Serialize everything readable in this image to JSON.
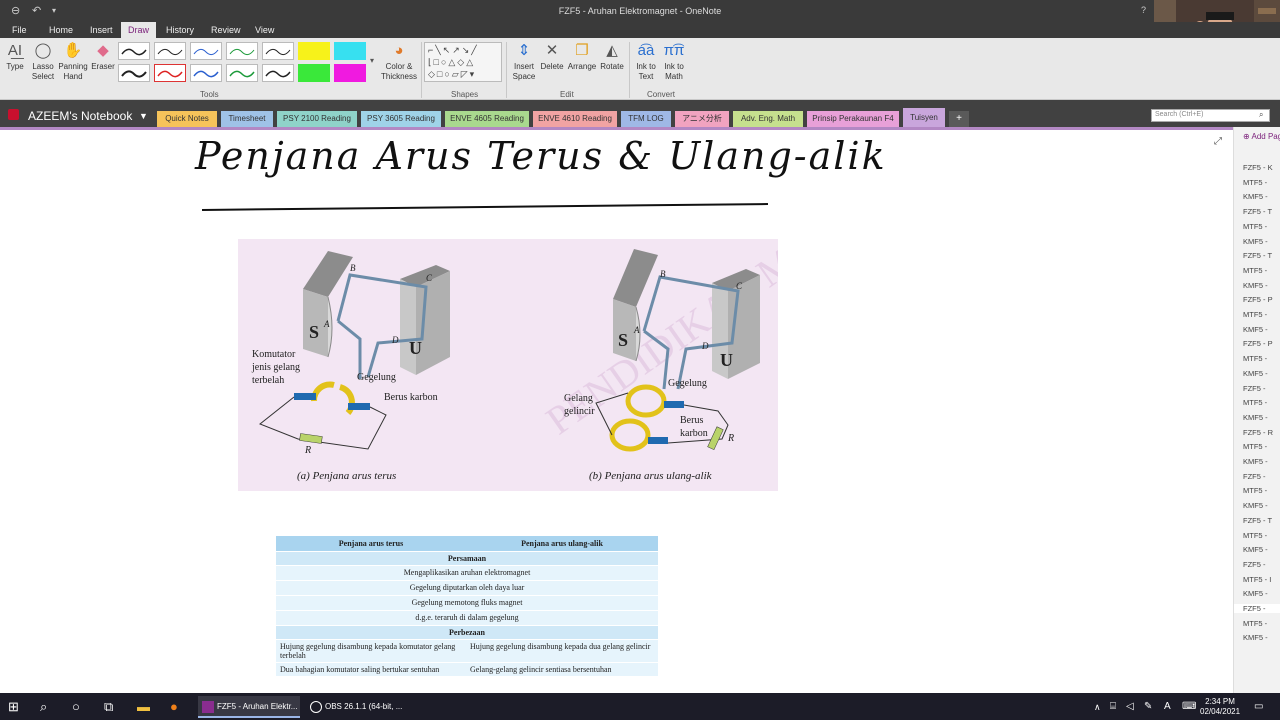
{
  "window": {
    "title": "FZF5 - Aruhan Elektromagnet - OneNote",
    "help_glyph": "?"
  },
  "menu": {
    "items": [
      "File",
      "Home",
      "Insert",
      "Draw",
      "History",
      "Review",
      "View"
    ],
    "active": "Draw"
  },
  "ribbon": {
    "tools": {
      "type": "Type",
      "lasso_1": "Lasso",
      "lasso_2": "Select",
      "panning_1": "Panning",
      "panning_2": "Hand",
      "eraser": "Eraser",
      "color_1": "Color &",
      "color_2": "Thickness",
      "group": "Tools"
    },
    "shapes_group": "Shapes",
    "edit": {
      "insert_1": "Insert",
      "insert_2": "Space",
      "delete": "Delete",
      "arrange": "Arrange",
      "rotate": "Rotate",
      "group": "Edit"
    },
    "convert": {
      "ink_text_1": "Ink to",
      "ink_text_2": "Text",
      "ink_math_1": "Ink to",
      "ink_math_2": "Math",
      "group": "Convert"
    }
  },
  "notebook": {
    "name": "AZEEM's Notebook",
    "tabs": [
      {
        "label": "Quick Notes",
        "color": "#f6c35a"
      },
      {
        "label": "Timesheet",
        "color": "#9fc2e7"
      },
      {
        "label": "PSY 2100 Reading",
        "color": "#8fd3c9"
      },
      {
        "label": "PSY 3605 Reading",
        "color": "#9fd3e8"
      },
      {
        "label": "ENVE 4605 Reading",
        "color": "#a9d98e"
      },
      {
        "label": "ENVE 4610 Reading",
        "color": "#f1a3a3"
      },
      {
        "label": "TFM LOG",
        "color": "#9fb8e6"
      },
      {
        "label": "アニメ分析",
        "color": "#f1a3c0"
      },
      {
        "label": "Adv. Eng. Math",
        "color": "#c6e08e"
      },
      {
        "label": "Prinsip Perakaunan F4",
        "color": "#e8a0d8"
      },
      {
        "label": "Tuisyen",
        "color": "#c9a6dc"
      }
    ],
    "add_tab": "+",
    "search_placeholder": "Search (Ctrl+E)"
  },
  "page": {
    "title": "Penjana Arus Terus & Ulang-alik"
  },
  "figure": {
    "a": {
      "caption": "(a) Penjana arus terus",
      "komutator": [
        "Komutator",
        "jenis gelang",
        "terbelah"
      ],
      "gegelung": "Gegelung",
      "berus": "Berus karbon",
      "R": "R",
      "S": "S",
      "U": "U",
      "A": "A",
      "B": "B",
      "C": "C",
      "D": "D"
    },
    "b": {
      "caption": "(b) Penjana arus ulang-alik",
      "gelang": [
        "Gelang",
        "gelincir"
      ],
      "gegelung": "Gegelung",
      "berus": [
        "Berus",
        "karbon"
      ],
      "R": "R",
      "S": "S",
      "U": "U",
      "A": "A",
      "B": "B",
      "C": "C",
      "D": "D"
    }
  },
  "table": {
    "headers": [
      "Penjana arus terus",
      "Penjana arus ulang-alik"
    ],
    "persamaan_label": "Persamaan",
    "persamaan": [
      "Mengaplikasikan aruhan elektromagnet",
      "Gegelung diputarkan oleh daya luar",
      "Gegelung memotong fluks magnet",
      "d.g.e. teraruh di dalam gegelung"
    ],
    "perbezaan_label": "Perbezaan",
    "perbezaan": [
      [
        "Hujung gegelung disambung kepada komutator gelang terbelah",
        "Hujung gegelung disambung kepada dua gelang gelincir"
      ],
      [
        "Dua bahagian komutator saling bertukar sentuhan",
        "Gelang-gelang gelincir sentiasa bersentuhan"
      ]
    ]
  },
  "sidepanel": {
    "add_page": "Add Page",
    "pages": [
      "FZF5 - K",
      "MTF5 -",
      "KMF5 -",
      "FZF5 - T",
      "MTF5 -",
      "KMF5 -",
      "FZF5 - T",
      "MTF5 -",
      "KMF5 -",
      "FZF5 - P",
      "MTF5 -",
      "KMF5 -",
      "FZF5 - P",
      "MTF5 -",
      "KMF5 -",
      "FZF5 -",
      "MTF5 -",
      "KMF5 -",
      "FZF5 - R",
      "MTF5 -",
      "KMF5 -",
      "FZF5 -",
      "MTF5 -",
      "KMF5 -",
      "FZF5 - T",
      "MTF5 -",
      "KMF5 -",
      "FZF5 -",
      "MTF5 - I",
      "KMF5 -",
      "FZF5 -",
      "MTF5 -",
      "KMF5 -"
    ],
    "selected_index": 30
  },
  "taskbar": {
    "apps": [
      "FZF5 - Aruhan Elektr...",
      "OBS 26.1.1 (64-bit, ..."
    ],
    "time": "2:34 PM",
    "date": "02/04/2021"
  }
}
